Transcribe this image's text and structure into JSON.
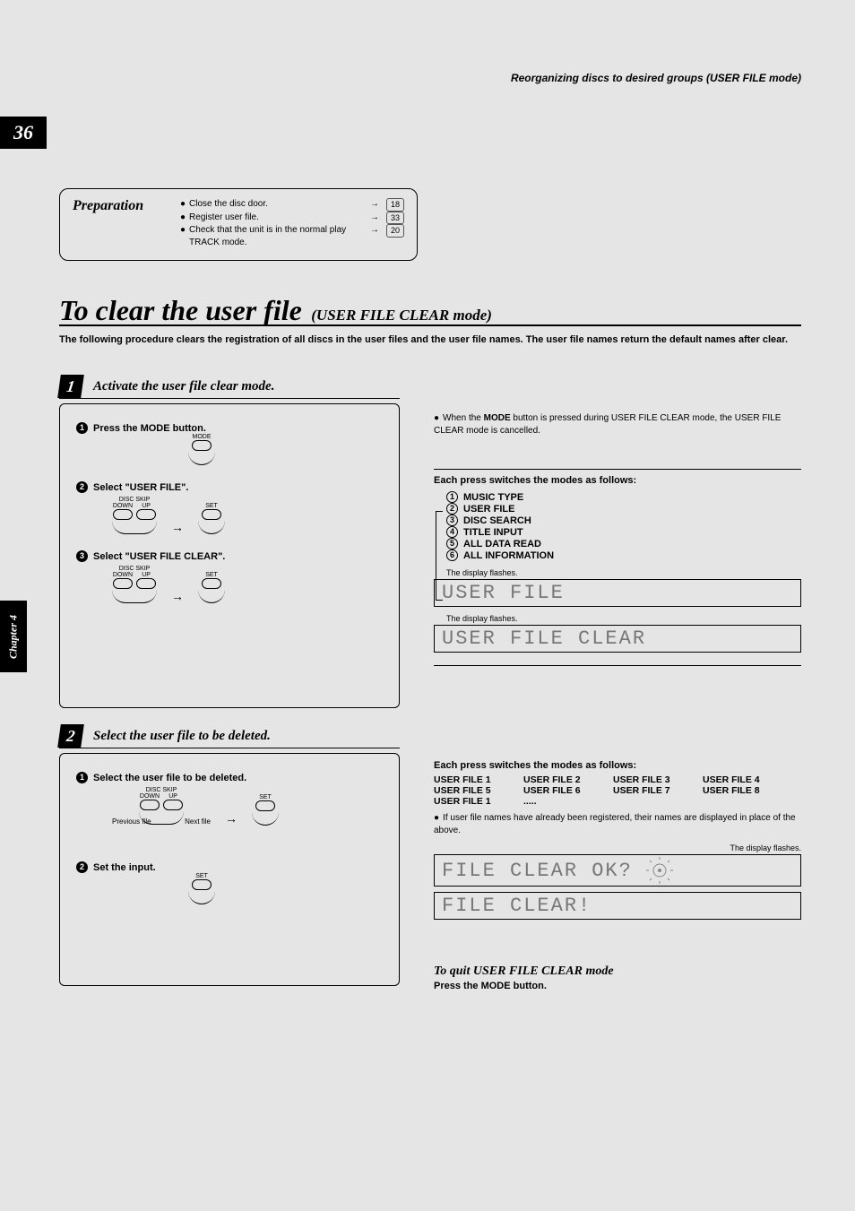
{
  "header": {
    "section": "Reorganizing discs to desired groups (USER FILE mode)"
  },
  "page_number": "36",
  "chapter_tab": "Chapter 4",
  "preparation": {
    "title": "Preparation",
    "items": [
      {
        "text": "Close the disc door.",
        "ref": "18"
      },
      {
        "text": "Register user file.",
        "ref": "33"
      },
      {
        "text": "Check that the unit is in the normal play TRACK mode.",
        "ref": "20"
      }
    ]
  },
  "title": {
    "main": "To clear the user file",
    "sub": "(USER FILE CLEAR mode)"
  },
  "intro": "The following procedure clears the registration of all discs in the user files and the user file names. The user file names return the default names after clear.",
  "steps": {
    "s1": {
      "caption": "Activate the user file clear mode.",
      "a": "Press the MODE button.",
      "b": "Select \"USER FILE\".",
      "c": "Select \"USER FILE CLEAR\"."
    },
    "s2": {
      "caption": "Select the user file to be deleted.",
      "a": "Select  the user  file to be deleted.",
      "b": "Set the input.",
      "prev": "Previous file",
      "next": "Next file"
    }
  },
  "labels": {
    "mode": "MODE",
    "set": "SET",
    "disc_skip": "DISC SKIP",
    "down": "DOWN",
    "up": "UP"
  },
  "right": {
    "note1a": "When the ",
    "note1b": "MODE",
    "note1c": " button is pressed during USER FILE CLEAR mode, the USER FILE CLEAR mode is cancelled.",
    "each_press": "Each press switches the modes as follows:",
    "modes": [
      "MUSIC TYPE",
      "USER FILE",
      "DISC SEARCH",
      "TITLE INPUT",
      "ALL DATA READ",
      "ALL INFORMATION"
    ],
    "disp_flash": "The display flashes.",
    "lcd1": "USER  FILE",
    "lcd2": "USER  FILE  CLEAR",
    "each_press2": "Each press switches the modes as follows:",
    "userfiles": [
      "USER FILE 1",
      "USER FILE 2",
      "USER FILE 3",
      "USER FILE 4",
      "USER FILE 5",
      "USER FILE 6",
      "USER FILE 7",
      "USER FILE 8",
      "USER FILE 1",
      "....."
    ],
    "note2": "If user file names have already been registered, their names are displayed in place of the above.",
    "lcd3": "FILE  CLEAR  OK?",
    "lcd4": "FILE  CLEAR!",
    "quit_title": "To quit USER FILE CLEAR mode",
    "quit_sub": "Press the MODE button."
  }
}
